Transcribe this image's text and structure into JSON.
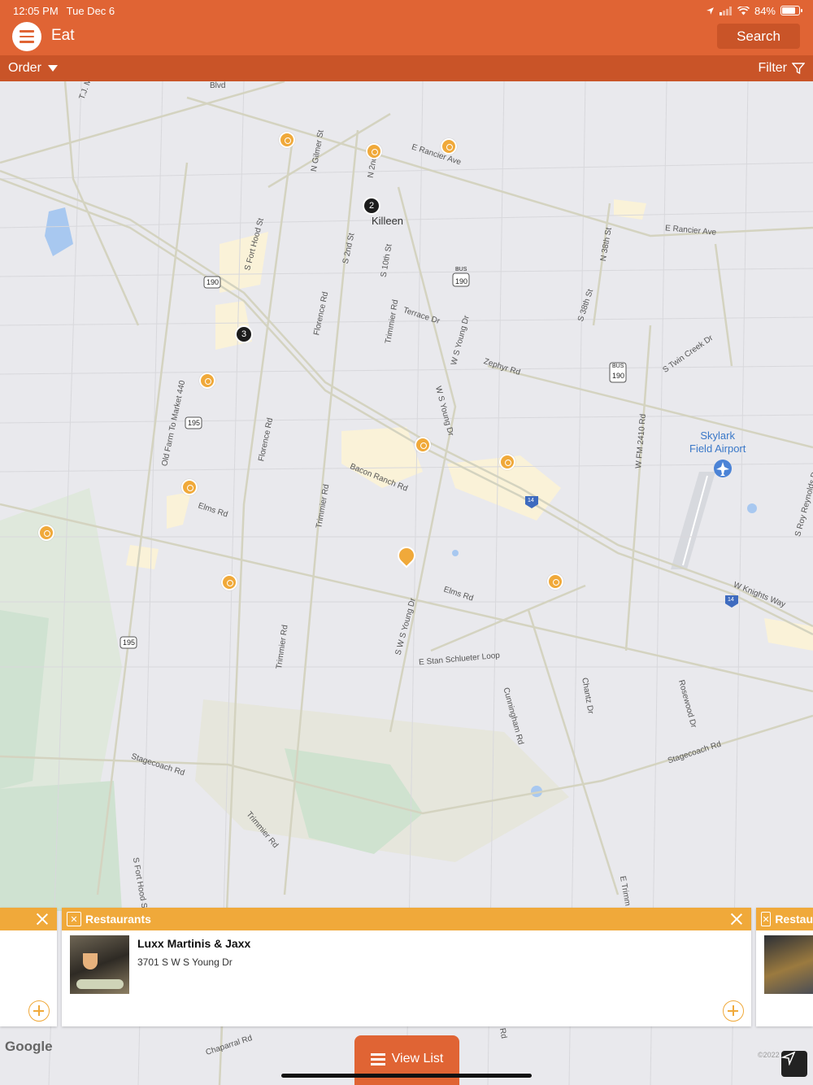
{
  "status_bar": {
    "time": "12:05 PM",
    "date": "Tue Dec 6",
    "battery": "84%",
    "battery_level": 0.84
  },
  "header": {
    "menu_icon": "hamburger-icon",
    "title": "Eat",
    "search_label": "Search"
  },
  "subbar": {
    "order_label": "Order",
    "filter_label": "Filter"
  },
  "map": {
    "city": "Killeen",
    "airport": "Skylark\nField Airport",
    "roads": [
      "Blvd",
      "T.J. M",
      "N Gilmer St",
      "N 2nd",
      "E Rancier Ave",
      "E Rancier Ave",
      "S Fort Hood St",
      "S 2nd St",
      "S 10th St",
      "N 38th St",
      "S 38th St",
      "Florence Rd",
      "Trimmier Rd",
      "Terrace Dr",
      "W S Young Dr",
      "Zephyr Rd",
      "S Twin Creek Dr",
      "Old Farm To Market 440",
      "Florence Rd",
      "W S Young Dr",
      "W FM 2410 Rd",
      "Bacon Ranch Rd",
      "Elms Rd",
      "Trimmier Rd",
      "S Roy Reynolds Dr",
      "Elms Rd",
      "W Knights Way",
      "S W S Young Dr",
      "E Stan Schlueter Loop",
      "Trimmier Rd",
      "Cunningham Rd",
      "Chantz Dr",
      "Rosewood Dr",
      "Stagecoach Rd",
      "Stagecoach Rd",
      "Trimmier Rd",
      "S Fort Hood S",
      "E Trimm",
      "Chaparral Rd",
      "Rd"
    ],
    "highway_shields": [
      "190",
      "190",
      "190",
      "195",
      "195",
      "14",
      "14"
    ],
    "highway_bus_label": "BUS",
    "clusters": [
      "2",
      "3"
    ],
    "attribution": "Google",
    "copyright": "©2022"
  },
  "cards": [
    {
      "category": "Restaurants",
      "name": "Luxx Martinis & Jaxx",
      "address": "3701 S W S Young Dr"
    },
    {
      "category": "Restau"
    }
  ],
  "view_list_label": "View List"
}
